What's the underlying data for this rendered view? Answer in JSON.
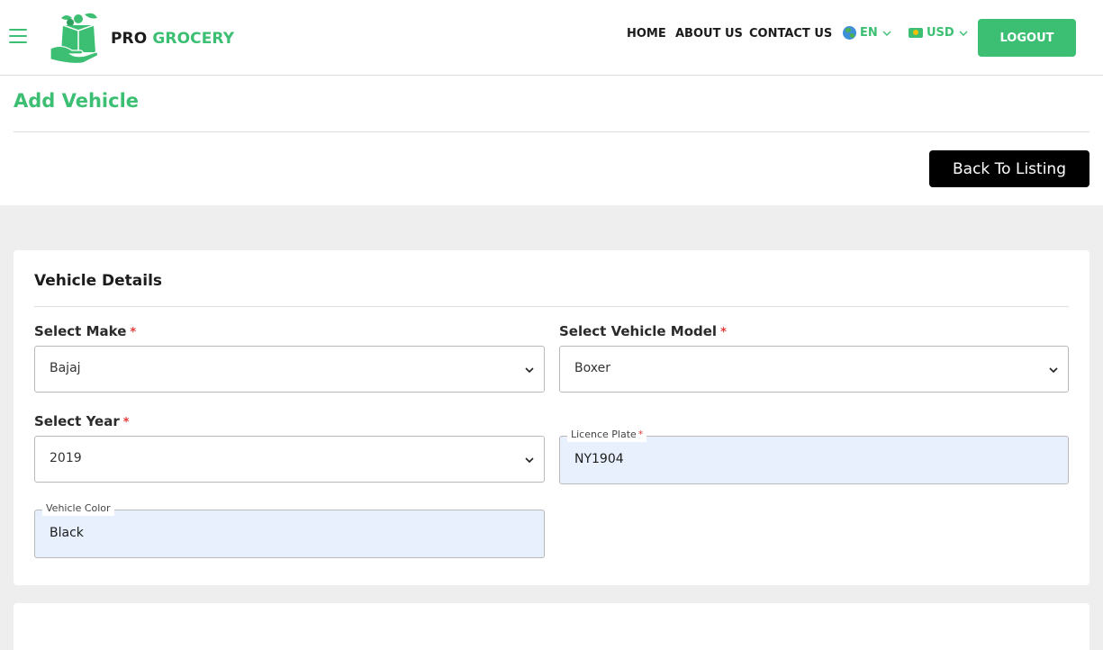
{
  "header": {
    "brand_first": "PRO",
    "brand_second": "GROCERY",
    "nav": [
      "HOME",
      "ABOUT US",
      "CONTACT US"
    ],
    "language": "EN",
    "currency": "USD",
    "logout_label": "LOGOUT"
  },
  "page": {
    "title": "Add Vehicle",
    "back_label": "Back To Listing"
  },
  "card": {
    "title": "Vehicle Details",
    "make": {
      "label": "Select Make",
      "required": "*",
      "value": "Bajaj"
    },
    "model": {
      "label": "Select Vehicle Model",
      "required": "*",
      "value": "Boxer"
    },
    "year": {
      "label": "Select Year",
      "required": "*",
      "value": "2019"
    },
    "licence": {
      "label": "Licence Plate",
      "required": "*",
      "value": "NY1904"
    },
    "color": {
      "label": "Vehicle Color",
      "value": "Black"
    }
  },
  "colors": {
    "accent": "#3dbf73",
    "background_grey": "#eeeeee",
    "autofill_blue": "#e8f0fe"
  },
  "icons": {
    "menu": "hamburger-icon",
    "logo": "grocery-bag-logo",
    "language": "globe-icon",
    "currency": "money-icon",
    "dropdown": "chevron-down-icon"
  }
}
